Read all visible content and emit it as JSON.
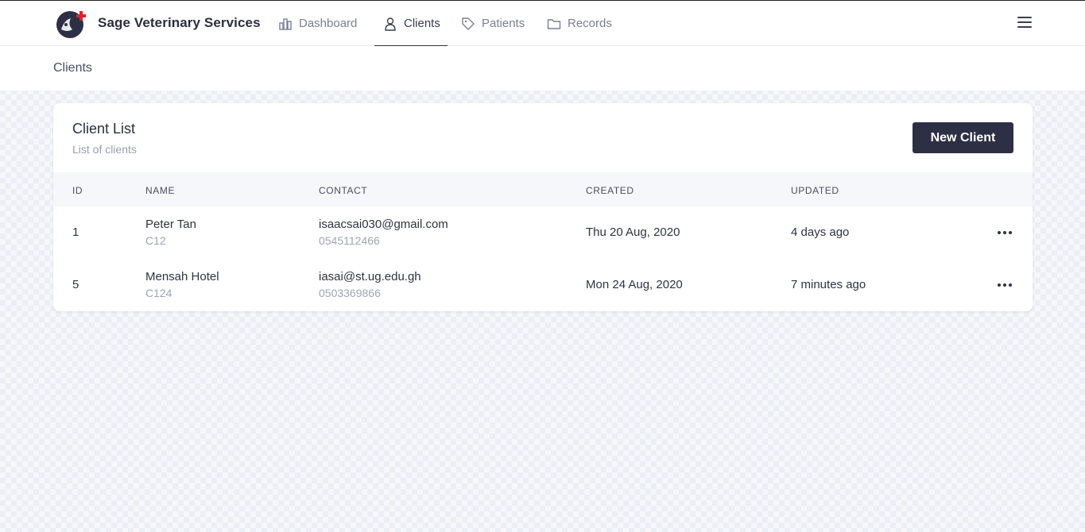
{
  "app": {
    "brand": "Sage Veterinary Services",
    "colors": {
      "accent": "#2d3044",
      "logo_cross": "#e0202e"
    }
  },
  "nav": {
    "items": [
      {
        "label": "Dashboard",
        "icon": "bar-chart-icon"
      },
      {
        "label": "Clients",
        "icon": "user-icon",
        "active": true
      },
      {
        "label": "Patients",
        "icon": "tag-icon"
      },
      {
        "label": "Records",
        "icon": "folder-icon"
      }
    ],
    "menu_icon": "hamburger-menu-icon"
  },
  "breadcrumb": {
    "current": "Clients"
  },
  "card": {
    "title": "Client List",
    "subtitle": "List of clients",
    "new_button": "New Client"
  },
  "table": {
    "headers": [
      "ID",
      "NAME",
      "CONTACT",
      "CREATED",
      "UPDATED"
    ],
    "rows": [
      {
        "id": "1",
        "name": "Peter Tan",
        "code": "C12",
        "email": "isaacsai030@gmail.com",
        "phone": "0545112466",
        "created": "Thu 20 Aug, 2020",
        "updated": "4 days ago"
      },
      {
        "id": "5",
        "name": "Mensah Hotel",
        "code": "C124",
        "email": "iasai@st.ug.edu.gh",
        "phone": "0503369866",
        "created": "Mon 24 Aug, 2020",
        "updated": "7 minutes ago"
      }
    ]
  }
}
